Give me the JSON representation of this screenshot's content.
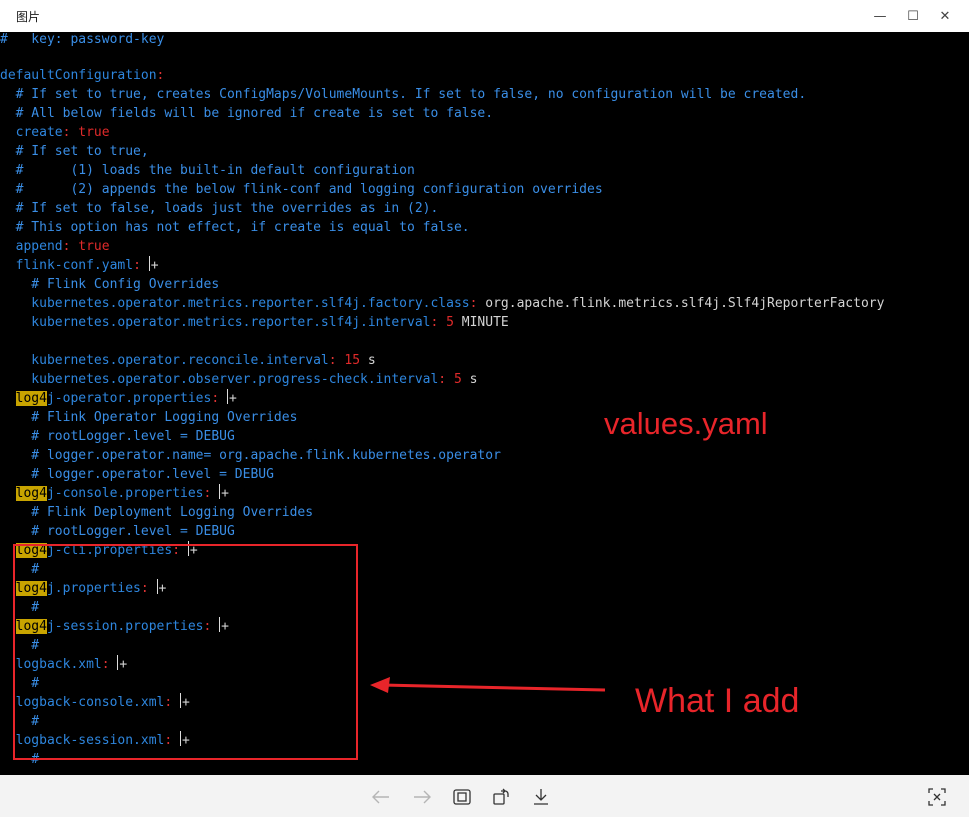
{
  "window": {
    "title": "图片",
    "minimize_glyph": "—",
    "maximize_glyph": "☐",
    "close_glyph": "✕"
  },
  "annotations": {
    "title": "values.yaml",
    "note": "What I add"
  },
  "colors": {
    "comment": "#3a8ee6",
    "key": "#2e86de",
    "value": "#e02a2a",
    "highlight": "#c8a400",
    "annotation": "#e8252a"
  },
  "code": {
    "l01": "#   key: password-key",
    "l02_key": "defaultConfiguration",
    "l03": "  # If set to true, creates ConfigMaps/VolumeMounts. If set to false, no configuration will be created.",
    "l04": "  # All below fields will be ignored if create is set to false.",
    "l05_key": "  create",
    "l05_val": "true",
    "l06": "  # If set to true,",
    "l07": "  #      (1) loads the built-in default configuration",
    "l08": "  #      (2) appends the below flink-conf and logging configuration overrides",
    "l09": "  # If set to false, loads just the overrides as in (2).",
    "l10": "  # This option has not effect, if create is equal to false.",
    "l11_key": "  append",
    "l11_val": "true",
    "l12_key": "  flink-conf.yaml",
    "l13": "    # Flink Config Overrides",
    "l14_key": "    kubernetes.operator.metrics.reporter.slf4j.factory.class",
    "l14_val": "org.apache.flink.metrics.slf4j.Slf4jReporterFactory",
    "l15_key": "    kubernetes.operator.metrics.reporter.slf4j.interval",
    "l15_num": "5",
    "l15_unit": "MINUTE",
    "l17_key": "    kubernetes.operator.reconcile.interval",
    "l17_num": "15",
    "l17_unit": "s",
    "l18_key": "    kubernetes.operator.observer.progress-check.interval",
    "l18_num": "5",
    "l18_unit": "s",
    "l19_hl": "log4",
    "l19_rest": "j-operator.properties",
    "l20": "    # Flink Operator Logging Overrides",
    "l21": "    # rootLogger.level = DEBUG",
    "l22": "    # logger.operator.name= org.apache.flink.kubernetes.operator",
    "l23": "    # logger.operator.level = DEBUG",
    "l24_hl": "log4",
    "l24_rest": "j-console.properties",
    "l25": "    # Flink Deployment Logging Overrides",
    "l26": "    # rootLogger.level = DEBUG",
    "l27_hl": "log4",
    "l27_rest": "j-cli.properties",
    "l28": "    #",
    "l29_hl": "log4",
    "l29_rest": "j.properties",
    "l30": "    #",
    "l31_hl": "log4",
    "l31_rest": "j-session.properties",
    "l32": "    #",
    "l33_key": "  logback.xml",
    "l34": "    #",
    "l35_key": "  logback-console.xml",
    "l36": "    #",
    "l37_key": "  logback-session.xml",
    "l38": "    #",
    "colon": ":",
    "colon_sp": ": ",
    "plus": "+",
    "indent2": "  "
  }
}
